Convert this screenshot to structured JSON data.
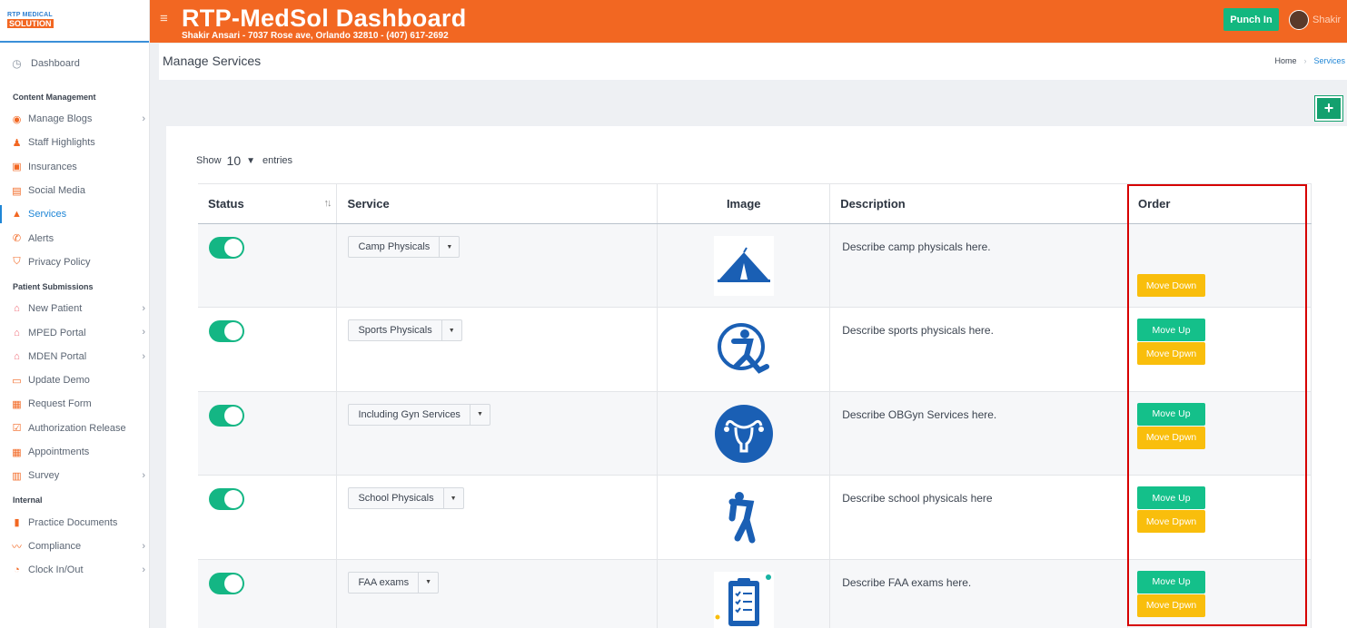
{
  "sidebar": {
    "logo_top": "RTP MEDICAL",
    "logo_bottom": "SOLUTION",
    "dashboard": "Dashboard",
    "sections": [
      {
        "heading": "Content Management",
        "items": [
          {
            "label": "Manage Blogs",
            "icon": "rss-icon",
            "chevron": true
          },
          {
            "label": "Staff Highlights",
            "icon": "staff-icon",
            "chevron": false
          },
          {
            "label": "Insurances",
            "icon": "briefcase-icon",
            "chevron": false
          },
          {
            "label": "Social Media",
            "icon": "social-icon",
            "chevron": false
          },
          {
            "label": "Services",
            "icon": "hill-icon",
            "chevron": false,
            "active": true
          },
          {
            "label": "Alerts",
            "icon": "phone-icon",
            "chevron": false
          },
          {
            "label": "Privacy Policy",
            "icon": "shield-icon",
            "chevron": false
          }
        ]
      },
      {
        "heading": "Patient Submissions",
        "items": [
          {
            "label": "New Patient",
            "icon": "home-icon",
            "chevron": true
          },
          {
            "label": "MPED Portal",
            "icon": "home-icon",
            "chevron": true
          },
          {
            "label": "MDEN Portal",
            "icon": "home-icon",
            "chevron": true
          },
          {
            "label": "Update Demo",
            "icon": "id-card-icon",
            "chevron": false
          },
          {
            "label": "Request Form",
            "icon": "form-icon",
            "chevron": false
          },
          {
            "label": "Authorization Release",
            "icon": "check-doc-icon",
            "chevron": false
          },
          {
            "label": "Appointments",
            "icon": "calendar-icon",
            "chevron": false
          },
          {
            "label": "Survey",
            "icon": "chart-icon",
            "chevron": true
          }
        ]
      },
      {
        "heading": "Internal",
        "items": [
          {
            "label": "Practice Documents",
            "icon": "clipboard-icon",
            "chevron": false
          },
          {
            "label": "Compliance",
            "icon": "signature-icon",
            "chevron": true
          },
          {
            "label": "Clock In/Out",
            "icon": "clock-icon",
            "chevron": true
          }
        ]
      }
    ]
  },
  "header": {
    "title": "RTP-MedSol Dashboard",
    "subtitle": "Shakir Ansari - 7037 Rose ave, Orlando 32810 - (407) 617-2692",
    "punch_in": "Punch In",
    "user_name": "Shakir"
  },
  "page": {
    "title": "Manage Services",
    "breadcrumb_home": "Home",
    "breadcrumb_current": "Services",
    "add_button": "+"
  },
  "table": {
    "show_label": "Show",
    "entries_value": "10",
    "entries_label": "entries",
    "columns": [
      "Status",
      "Service",
      "Image",
      "Description",
      "Order"
    ],
    "rows": [
      {
        "service": "Camp Physicals",
        "image_icon": "tent-icon",
        "description": "Describe camp physicals here.",
        "move_up": null,
        "move_down": "Move Down"
      },
      {
        "service": "Sports Physicals",
        "image_icon": "gymnast-icon",
        "description": "Describe sports physicals here.",
        "move_up": "Move Up",
        "move_down": "Move Dpwn"
      },
      {
        "service": "Including Gyn Services",
        "image_icon": "uterus-icon",
        "description": "Describe OBGyn Services here.",
        "move_up": "Move Up",
        "move_down": "Move Dpwn"
      },
      {
        "service": "School Physicals",
        "image_icon": "child-stretch-icon",
        "description": "Describe school physicals here",
        "move_up": "Move Up",
        "move_down": "Move Dpwn"
      },
      {
        "service": "FAA exams",
        "image_icon": "checklist-icon",
        "description": "Describe FAA exams here.",
        "move_up": "Move Up",
        "move_down": "Move Dpwn"
      }
    ]
  },
  "colors": {
    "brand_orange": "#f26722",
    "accent_blue": "#1f86d6",
    "toggle_green": "#14b684",
    "move_up_green": "#14c08a",
    "move_down_yellow": "#f9be0c",
    "highlight_red": "#d60000"
  }
}
